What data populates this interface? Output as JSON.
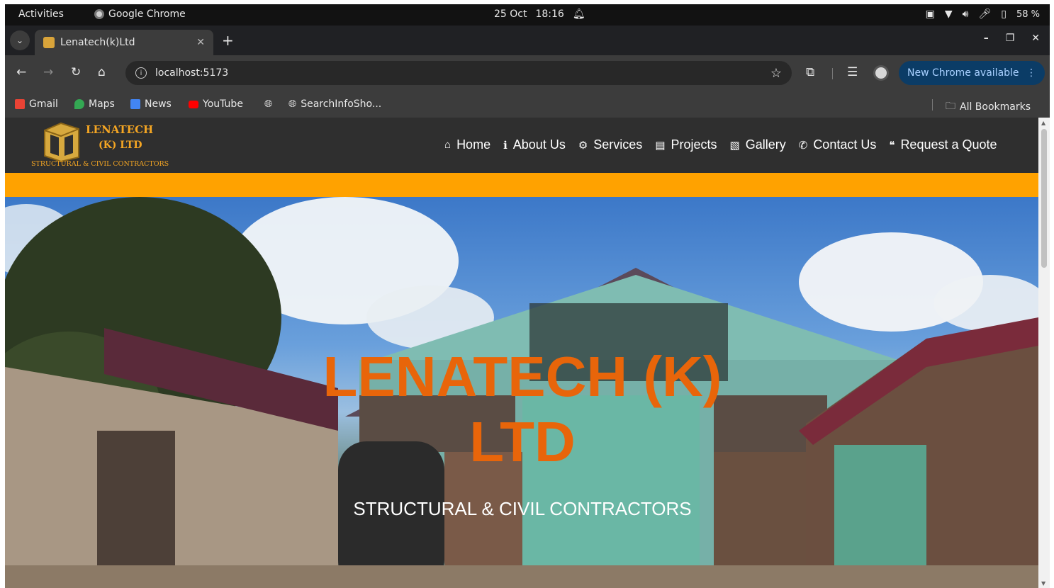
{
  "system_bar": {
    "activities": "Activities",
    "app_name": "Google Chrome",
    "date": "25 Oct",
    "time": "18:16",
    "battery": "58 %"
  },
  "browser": {
    "tab_title": "Lenatech(k)Ltd",
    "url": "localhost:5173",
    "update_label": "New Chrome available",
    "bookmarks": [
      "Gmail",
      "Maps",
      "News",
      "YouTube",
      "SearchInfoSho..."
    ],
    "all_bookmarks": "All Bookmarks"
  },
  "site": {
    "logo_line1": "LENATECH",
    "logo_line2": "(K) LTD",
    "logo_tagline": "STRUCTURAL & CIVIL CONTRACTORS",
    "nav": [
      {
        "label": "Home",
        "icon": "home-icon"
      },
      {
        "label": "About Us",
        "icon": "info-icon"
      },
      {
        "label": "Services",
        "icon": "gears-icon"
      },
      {
        "label": "Projects",
        "icon": "briefcase-icon"
      },
      {
        "label": "Gallery",
        "icon": "images-icon"
      },
      {
        "label": "Contact Us",
        "icon": "phone-icon"
      },
      {
        "label": "Request a Quote",
        "icon": "quote-icon"
      }
    ],
    "hero_title": "LENATECH (K) LTD",
    "hero_subtitle": "STRUCTURAL & CIVIL CONTRACTORS",
    "colors": {
      "accent": "#ffa200",
      "header": "#2f2f2f",
      "hero_title": "#e8650a"
    }
  }
}
